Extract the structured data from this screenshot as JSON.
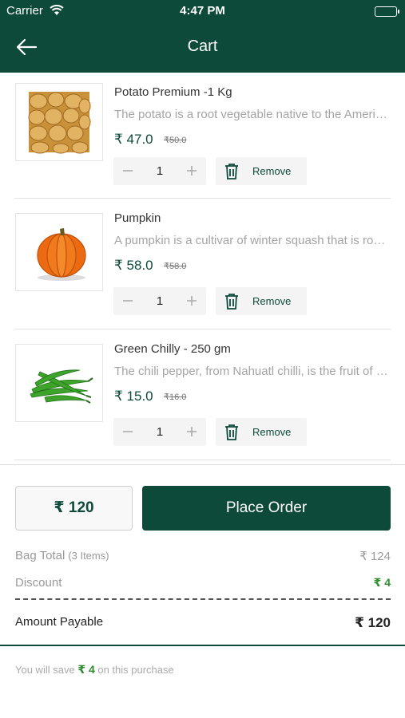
{
  "status_bar": {
    "carrier": "Carrier",
    "time": "4:47 PM"
  },
  "header": {
    "title": "Cart",
    "back_icon": "arrow-left-icon"
  },
  "items": [
    {
      "name": "Potato Premium -1 Kg",
      "description": "The potato is a root vegetable native to the Americas",
      "price": "₹ 47.0",
      "mrp": "₹50.0",
      "quantity": "1",
      "remove_label": "Remove",
      "image_icon": "potato-image"
    },
    {
      "name": "Pumpkin",
      "description": "A pumpkin is a cultivar of winter squash that is round",
      "price": "₹ 58.0",
      "mrp": "₹58.0",
      "quantity": "1",
      "remove_label": "Remove",
      "image_icon": "pumpkin-image"
    },
    {
      "name": "Green Chilly - 250 gm",
      "description": "The chili pepper, from Nahuatl chilli, is the fruit of plants",
      "price": "₹ 15.0",
      "mrp": "₹16.0",
      "quantity": "1",
      "remove_label": "Remove",
      "image_icon": "chilly-image"
    }
  ],
  "checkout": {
    "total_button": "₹ 120",
    "place_order_label": "Place Order"
  },
  "summary": {
    "bag_total_label": "Bag Total",
    "bag_total_count": "(3 Items)",
    "bag_total_value": "₹ 124",
    "discount_label": "Discount",
    "discount_value": "₹ 4",
    "payable_label": "Amount Payable",
    "payable_value": "₹ 120"
  },
  "savings": {
    "prefix": "You will save",
    "amount": "₹ 4",
    "suffix": "on this purchase"
  },
  "colors": {
    "brand": "#0d4a3a",
    "discount": "#2e8b2e",
    "muted": "#a4a4a4"
  }
}
